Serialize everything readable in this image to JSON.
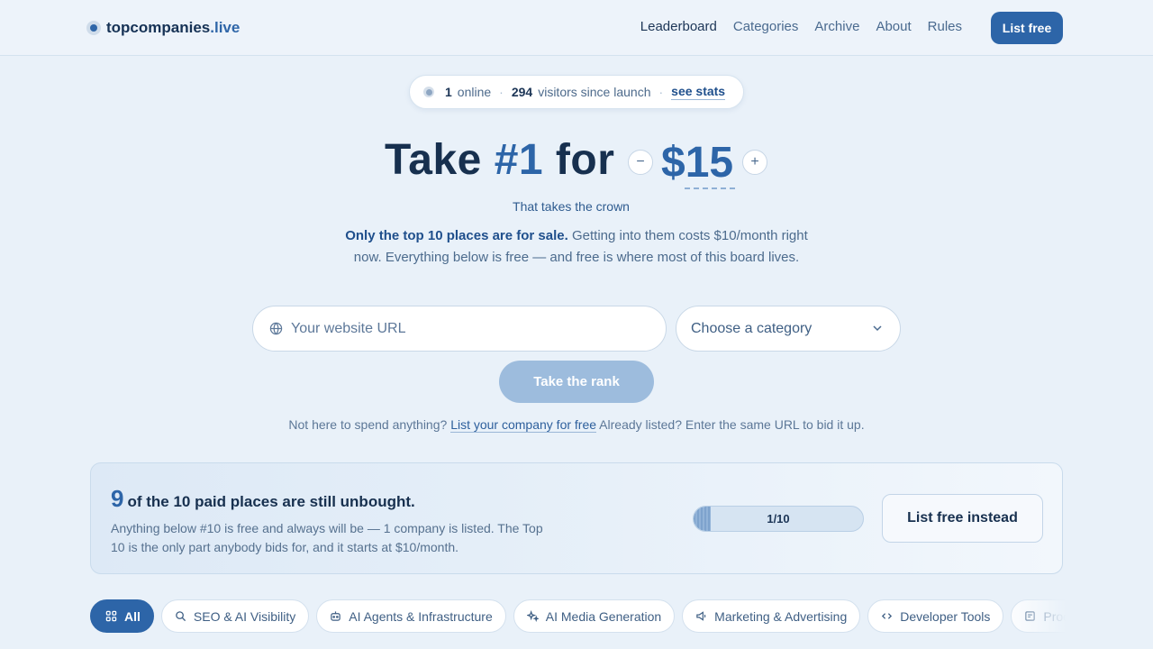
{
  "brand": {
    "name": "topcompanies",
    "tld": ".live"
  },
  "nav": {
    "items": [
      "Leaderboard",
      "Categories",
      "Archive",
      "About",
      "Rules"
    ]
  },
  "header_cta": "List free",
  "stats": {
    "online_count": "1",
    "online_label": "online",
    "visitors_count": "294",
    "visitors_label": "visitors since launch",
    "link": "see stats"
  },
  "hero": {
    "take": "Take",
    "rank": "#1",
    "for": "for",
    "minus": "−",
    "price": "$15",
    "plus": "+",
    "crown": "That takes the crown",
    "lede_bold": "Only the top 10 places are for sale.",
    "lede_rest": " Getting into them costs $10/month right now. Everything below is free — and free is where most of this board lives."
  },
  "form": {
    "url_placeholder": "Your website URL",
    "category_value": "Choose a category",
    "submit": "Take the rank"
  },
  "note": {
    "prefix": "Not here to spend anything?",
    "link": "List your company for free",
    "suffix": "Already listed? Enter the same URL to bid it up."
  },
  "banner": {
    "count": "9",
    "headline": "of the 10 paid places are still unbought.",
    "sub": "Anything below #10 is free and always will be — 1 company is listed. The Top 10 is the only part anybody bids for, and it starts at $10/month.",
    "progress_label": "1/10",
    "progress_fraction": 0.1,
    "button": "List free instead"
  },
  "chips": [
    {
      "label": "All",
      "icon": "grid-icon",
      "active": true
    },
    {
      "label": "SEO & AI Visibility",
      "icon": "search-icon"
    },
    {
      "label": "AI Agents & Infrastructure",
      "icon": "robot-icon"
    },
    {
      "label": "AI Media Generation",
      "icon": "sparkles-icon"
    },
    {
      "label": "Marketing & Advertising",
      "icon": "megaphone-icon"
    },
    {
      "label": "Developer Tools",
      "icon": "code-icon"
    },
    {
      "label": "Productivity",
      "icon": "note-icon"
    }
  ],
  "colors": {
    "accent": "#2d65a8",
    "background": "#e9f1f9",
    "heading": "#17304f"
  }
}
